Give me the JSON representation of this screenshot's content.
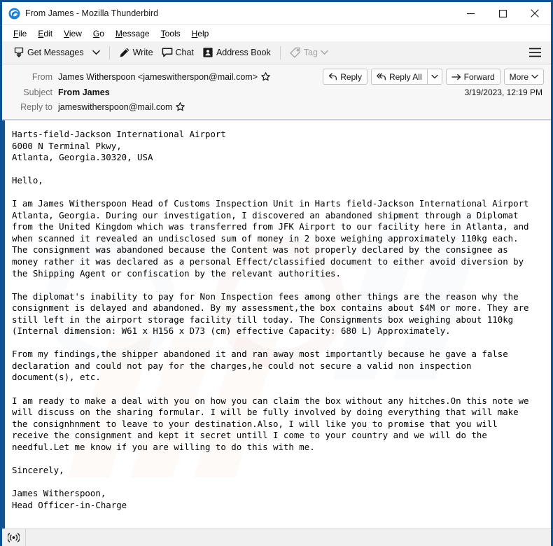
{
  "window": {
    "title": "From James - Mozilla Thunderbird",
    "logo_icon": "thunderbird-logo-icon",
    "minimize_label": "Minimize",
    "maximize_label": "Maximize",
    "close_label": "Close"
  },
  "menubar": {
    "items": [
      {
        "label": "File",
        "accesskey": "F"
      },
      {
        "label": "Edit",
        "accesskey": "E"
      },
      {
        "label": "View",
        "accesskey": "V"
      },
      {
        "label": "Go",
        "accesskey": "G"
      },
      {
        "label": "Message",
        "accesskey": "M"
      },
      {
        "label": "Tools",
        "accesskey": "T"
      },
      {
        "label": "Help",
        "accesskey": "H"
      }
    ]
  },
  "toolbar": {
    "get_messages_label": "Get Messages",
    "get_messages_icon": "download-inbox-icon",
    "get_messages_dropdown_icon": "chevron-down-icon",
    "write_label": "Write",
    "write_icon": "pencil-icon",
    "chat_label": "Chat",
    "chat_icon": "speech-bubble-icon",
    "address_book_label": "Address Book",
    "address_book_icon": "contact-card-icon",
    "tag_label": "Tag",
    "tag_icon": "tag-icon",
    "tag_dropdown_icon": "chevron-down-icon",
    "tag_disabled": true,
    "app_menu_icon": "hamburger-menu-icon"
  },
  "message_header": {
    "from_label": "From",
    "from_value": "James Witherspoon <jameswitherspon@mail.com>",
    "from_star_icon": "star-outline-icon",
    "subject_label": "Subject",
    "subject_value": "From James",
    "reply_to_label": "Reply to",
    "reply_to_value": "jameswitherspoon@mail.com",
    "reply_to_star_icon": "star-outline-icon",
    "date": "3/19/2023, 12:19 PM",
    "actions": {
      "reply_label": "Reply",
      "reply_icon": "reply-arrow-icon",
      "reply_all_label": "Reply All",
      "reply_all_icon": "reply-all-arrow-icon",
      "reply_all_dropdown_icon": "chevron-down-icon",
      "forward_label": "Forward",
      "forward_icon": "forward-arrow-icon",
      "more_label": "More",
      "more_dropdown_icon": "chevron-down-icon"
    }
  },
  "message_body": {
    "text": "Harts-field-Jackson International Airport\n6000 N Terminal Pkwy,\nAtlanta, Georgia.30320, USA\n\nHello,\n\nI am James Witherspoon Head of Customs Inspection Unit in Harts field-Jackson International Airport\nAtlanta, Georgia. During our investigation, I discovered an abandoned shipment through a Diplomat\nfrom the United Kingdom which was transferred from JFK Airport to our facility here in Atlanta, and\nwhen scanned it revealed an undisclosed sum of money in 2 boxe weighing approximately 110kg each.\nThe consignment was abandoned because the Content was not properly declared by the consignee as\nmoney rather it was declared as a personal Effect/classified document to either avoid diversion by\nthe Shipping Agent or confiscation by the relevant authorities.\n\nThe diplomat's inability to pay for Non Inspection fees among other things are the reason why the\nconsignment is delayed and abandoned. By my assessment,the box contains about $4M or more. They are\nstill left in the airport storage facility till today. The Consignments box weighing about 110kg\n(Internal dimension: W61 x H156 x D73 (cm) effective Capacity: 680 L) Approximately.\n\nFrom my findings,the shipper abandoned it and ran away most importantly because he gave a false\ndeclaration and could not pay for the charges,he could not secure a valid non inspection\ndocument(s), etc.\n\nI am ready to make a deal with you on how you can claim the box without any hitches.On this note we\nwill discuss on the sharing formular. I will be fully involved by doing everything that will make\nthe consignhnment to leave to your destination.Also, I will like you to promise that you will\nreceive the consignment and kept it secret untill I come to your country and we will do the\nneedful.Let me know if you are willing to do this with me.\n\nSincerely,\n\nJames Witherspoon,\nHead Officer-in-Charge"
  },
  "statusbar": {
    "connection_icon": "online-signal-icon",
    "text": ""
  },
  "colors": {
    "window_frame": "#0b5394",
    "body_accent_bar": "#1c4f84",
    "header_background": "#f7f7f7",
    "toolbar_background": "#f2f2f2",
    "header_separator": "#c5cede",
    "disabled_text": "#a5a5a5"
  }
}
